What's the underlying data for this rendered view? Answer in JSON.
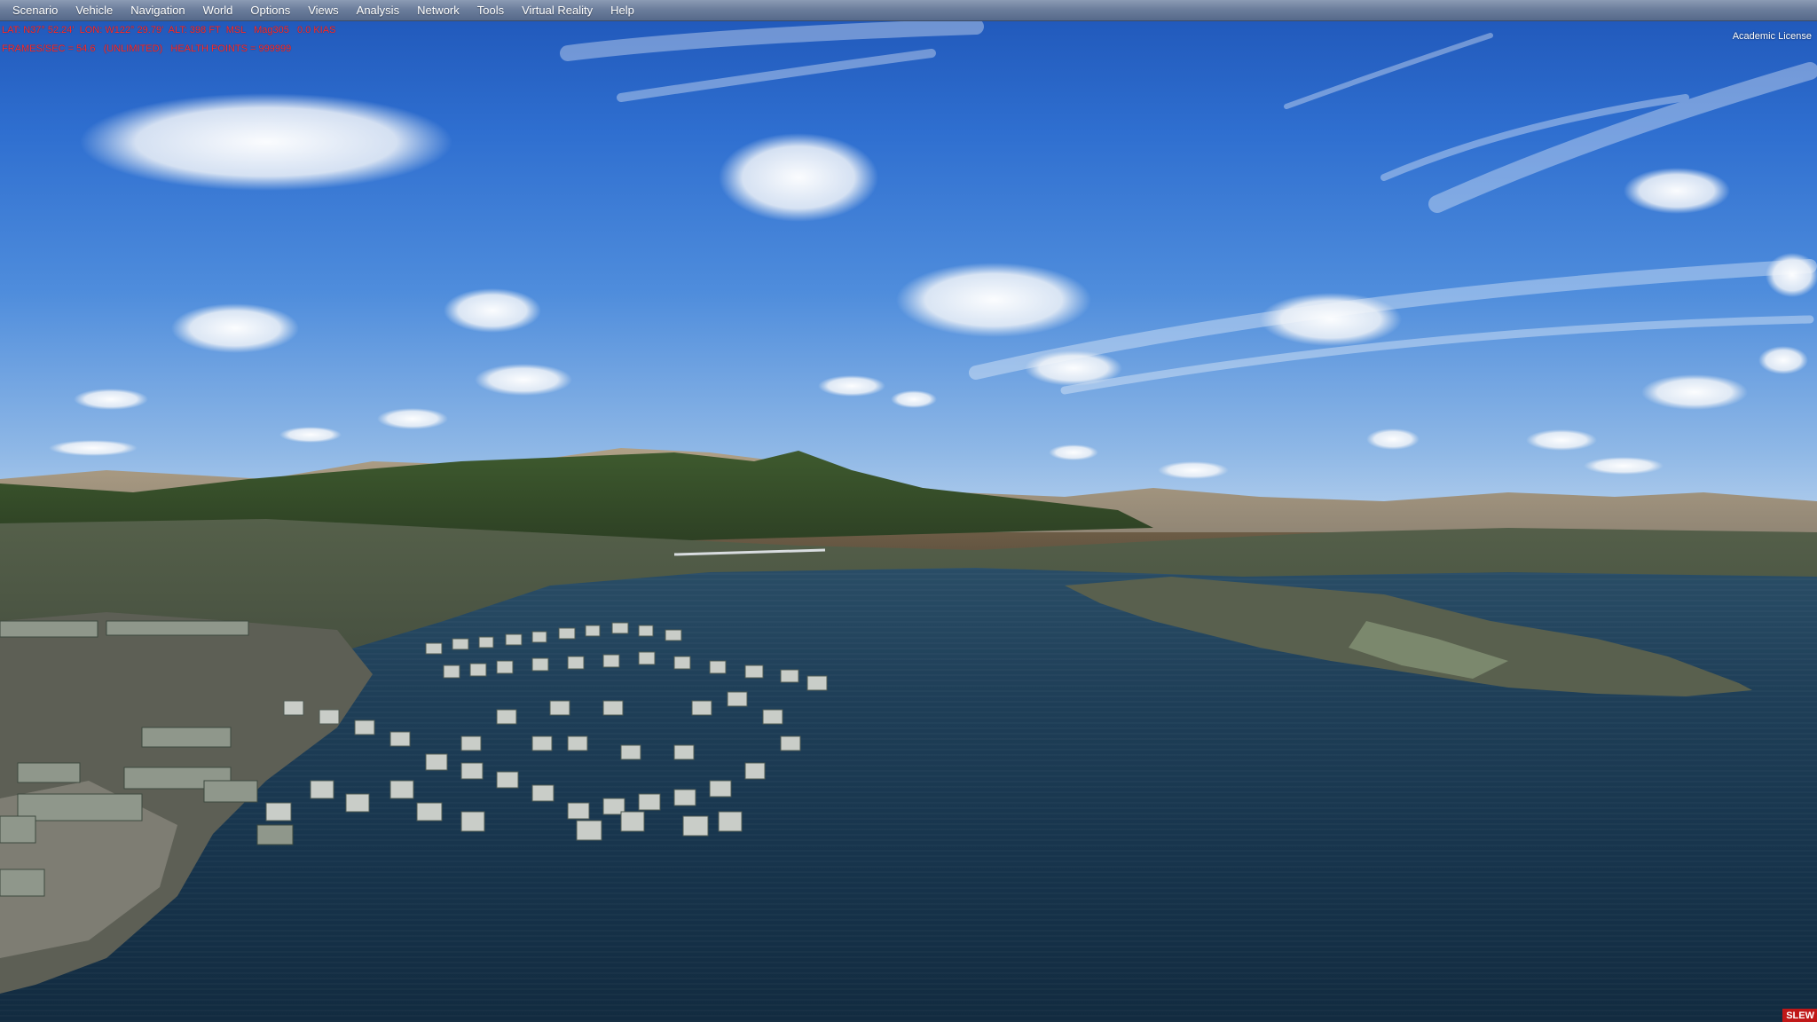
{
  "menu": {
    "items": [
      {
        "label": "Scenario"
      },
      {
        "label": "Vehicle"
      },
      {
        "label": "Navigation"
      },
      {
        "label": "World"
      },
      {
        "label": "Options"
      },
      {
        "label": "Views"
      },
      {
        "label": "Analysis"
      },
      {
        "label": "Network"
      },
      {
        "label": "Tools"
      },
      {
        "label": "Virtual Reality"
      },
      {
        "label": "Help"
      }
    ]
  },
  "hud": {
    "position_line": "LAT: N37° 52.24'  LON: W122° 29.79'  ALT: 398 FT  MSL   Mag305   0.0 KIAS",
    "stats_line": "FRAMES/SEC = 54.6   (UNLIMITED)   HEALTH POINTS = 999999"
  },
  "license_text": "Academic License",
  "slew_badge": "SLEW",
  "colors": {
    "hud_text": "#ff2a2a",
    "menubar": "#6c7e9c",
    "slew_badge": "#c01818"
  }
}
